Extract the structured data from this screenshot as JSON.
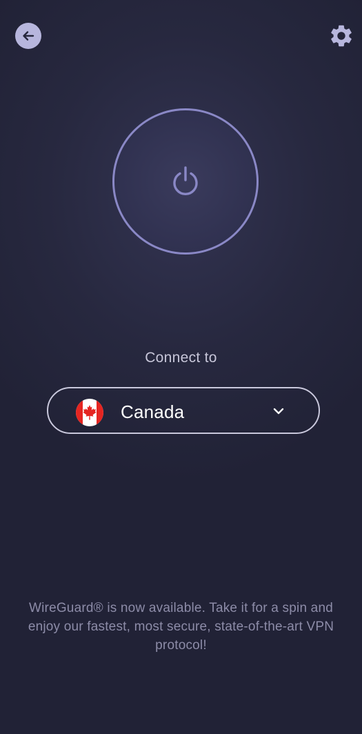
{
  "header": {
    "back_icon": "arrow-left-icon",
    "settings_icon": "gear-icon"
  },
  "power": {
    "icon": "power-icon",
    "ring_color": "#8a88c6"
  },
  "connect": {
    "label": "Connect to",
    "selected_country": "Canada",
    "flag_icon": "canada-flag-icon",
    "dropdown_icon": "chevron-down-icon"
  },
  "footer": {
    "message": "WireGuard® is now available. Take it for a spin and enjoy our fastest, most secure, state-of-the-art VPN protocol!"
  },
  "colors": {
    "background": "#27283f",
    "accent": "#8a88c6",
    "text_primary": "#ffffff",
    "text_secondary": "#c7c6d9",
    "text_muted": "#8d8ca8"
  }
}
